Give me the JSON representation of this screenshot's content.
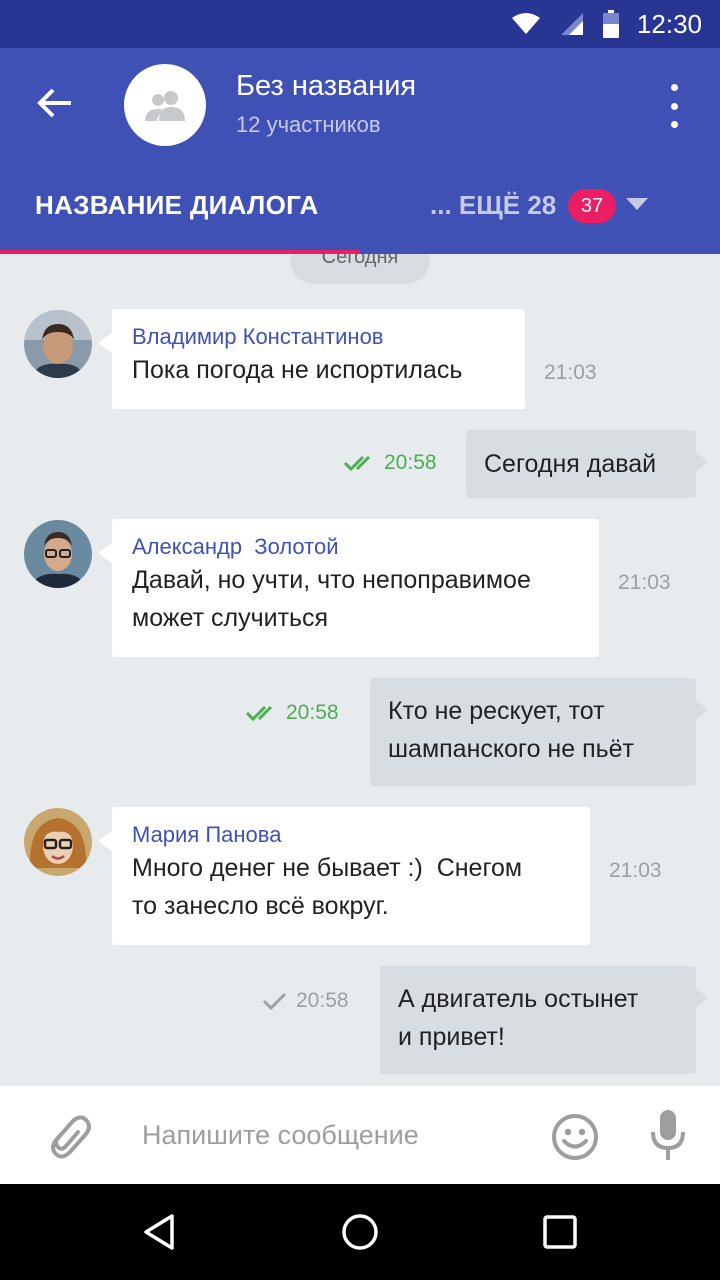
{
  "status_bar": {
    "time": "12:30"
  },
  "app_bar": {
    "title": "Без названия",
    "subtitle": "12 участников"
  },
  "tabs": {
    "active_label": "НАЗВАНИЕ ДИАЛОГА",
    "more_label": "... ЕЩЁ 28",
    "badge_count": "37"
  },
  "date_divider": "Сегодня",
  "messages": [
    {
      "direction": "in",
      "sender": "Владимир Константинов",
      "text": "Пока погода не испортилась",
      "time": "21:03"
    },
    {
      "direction": "out",
      "status": "read",
      "text": "Сегодня давай",
      "time": "20:58"
    },
    {
      "direction": "in",
      "sender": "Александр  Золотой",
      "text_line1": "Давай, но учти, что непоправимое",
      "text_line2": "может случиться",
      "time": "21:03"
    },
    {
      "direction": "out",
      "status": "read",
      "text_line1": "Кто не рескует, тот",
      "text_line2": "шампанского не пьёт",
      "time": "20:58"
    },
    {
      "direction": "in",
      "sender": "Мария Панова",
      "text_line1": "Много денег не бывает :)  Снегом",
      "text_line2": "то занесло всё вокруг.",
      "time": "21:03"
    },
    {
      "direction": "out",
      "status": "sent",
      "text_line1": "А двигатель остынет",
      "text_line2": "и привет!",
      "time": "20:58"
    }
  ],
  "composer": {
    "placeholder": "Напишите сообщение"
  },
  "colors": {
    "status_bar": "#283593",
    "app_bar": "#3f51b5",
    "accent": "#e91e63",
    "read_check": "#4caf50",
    "background": "#e8ebee"
  },
  "icons": {
    "status": [
      "wifi-icon",
      "signal-icon",
      "battery-icon"
    ],
    "app_bar": [
      "back-arrow-icon",
      "group-icon",
      "more-vert-icon"
    ],
    "composer": [
      "paperclip-icon",
      "emoji-icon",
      "microphone-icon"
    ],
    "nav": [
      "nav-back-icon",
      "nav-home-icon",
      "nav-recents-icon"
    ]
  }
}
